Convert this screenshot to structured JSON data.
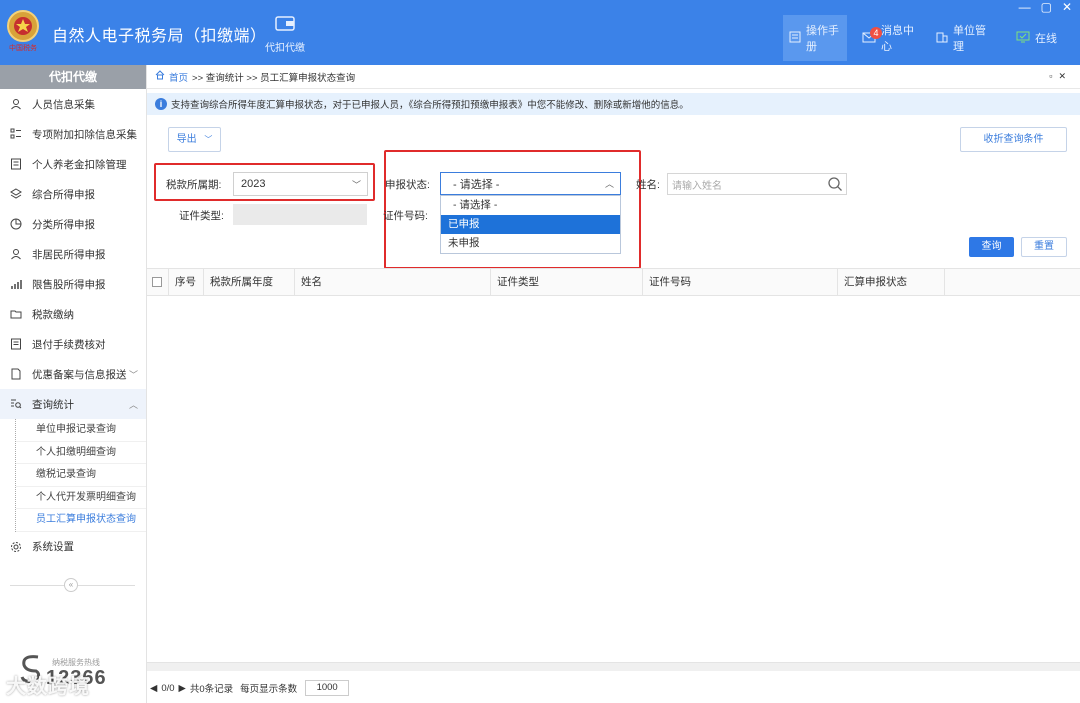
{
  "header": {
    "title": "自然人电子税务局（扣缴端）",
    "tool_label": "代扣代缴",
    "manual": "操作手册",
    "messages": "消息中心",
    "messages_badge": "4",
    "unit_mgmt": "单位管理",
    "online": "在线",
    "logo_text": "中国税务",
    "accent": "#3b82e8"
  },
  "sidebar": {
    "header": "代扣代缴",
    "items": [
      {
        "label": "人员信息采集",
        "icon": "person-icon"
      },
      {
        "label": "专项附加扣除信息采集",
        "icon": "list-icon"
      },
      {
        "label": "个人养老金扣除管理",
        "icon": "document-icon"
      },
      {
        "label": "综合所得申报",
        "icon": "layers-icon"
      },
      {
        "label": "分类所得申报",
        "icon": "pie-icon"
      },
      {
        "label": "非居民所得申报",
        "icon": "user-icon"
      },
      {
        "label": "限售股所得申报",
        "icon": "bar-chart-icon"
      },
      {
        "label": "税款缴纳",
        "icon": "folder-icon"
      },
      {
        "label": "退付手续费核对",
        "icon": "receipt-icon"
      },
      {
        "label": "优惠备案与信息报送",
        "icon": "file-icon"
      },
      {
        "label": "查询统计",
        "icon": "query-icon"
      }
    ],
    "sub_items": [
      "单位申报记录查询",
      "个人扣缴明细查询",
      "缴税记录查询",
      "个人代开发票明细查询",
      "员工汇算申报状态查询"
    ],
    "settings": "系统设置",
    "hotline_label": "纳税服务热线",
    "hotline_number": "12366"
  },
  "breadcrumb": {
    "home": "首页",
    "path": ">> 查询统计 >> 员工汇算申报状态查询"
  },
  "notice": "支持查询综合所得年度汇算申报状态，对于已申报人员，《综合所得预扣预缴申报表》中您不能修改、删除或新增他的信息。",
  "toolbar": {
    "export": "导出",
    "collapse": "收折查询条件"
  },
  "form": {
    "tax_period_label": "税款所属期:",
    "tax_period_value": "2023",
    "status_label": "申报状态:",
    "status_value": "- 请选择 -",
    "name_label": "姓名:",
    "name_placeholder": "请输入姓名",
    "id_type_label": "证件类型:",
    "id_number_label": "证件号码:",
    "status_options": [
      "- 请选择 -",
      "已申报",
      "未申报"
    ],
    "query": "查询",
    "reset": "重置"
  },
  "table": {
    "columns": [
      "序号",
      "税款所属年度",
      "姓名",
      "证件类型",
      "证件号码",
      "汇算申报状态"
    ]
  },
  "pager": {
    "pages": "0/0",
    "total": "共0条记录",
    "per_page_label": "每页显示条数",
    "per_page": "1000"
  },
  "watermark": "大数跨境"
}
